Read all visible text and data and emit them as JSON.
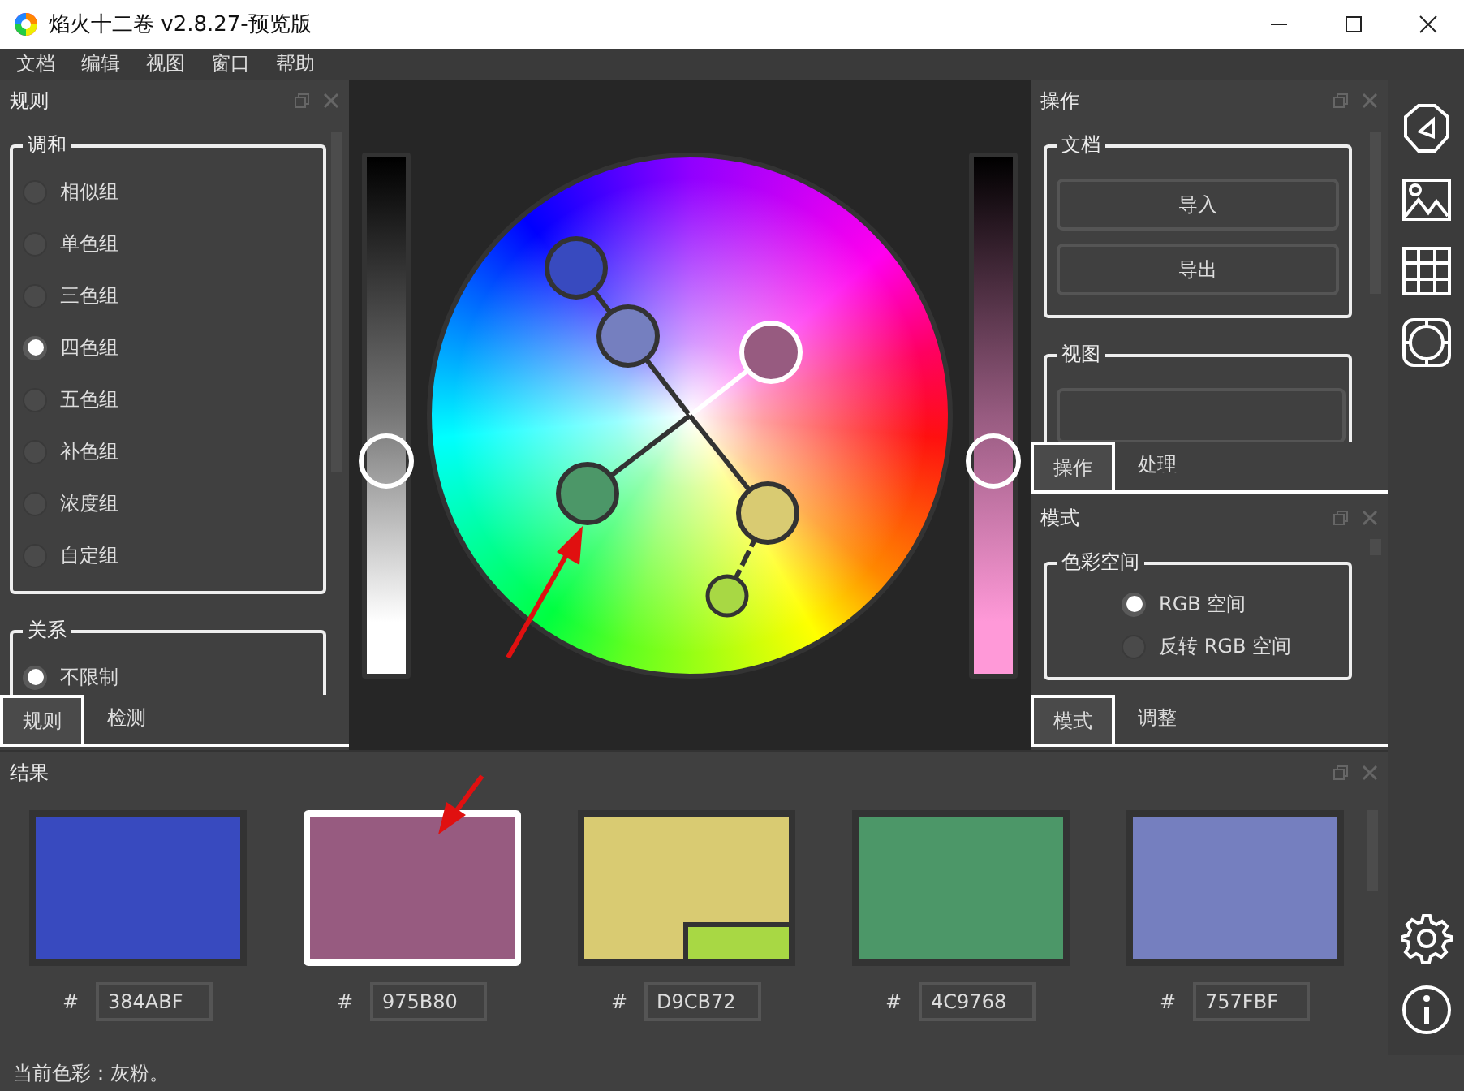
{
  "window": {
    "title": "焰火十二卷 v2.8.27-预览版"
  },
  "menu": [
    "文档",
    "编辑",
    "视图",
    "窗口",
    "帮助"
  ],
  "rules_panel": {
    "title": "规则",
    "groups": [
      {
        "title": "调和",
        "options": [
          {
            "label": "相似组",
            "selected": false
          },
          {
            "label": "单色组",
            "selected": false
          },
          {
            "label": "三色组",
            "selected": false
          },
          {
            "label": "四色组",
            "selected": true
          },
          {
            "label": "五色组",
            "selected": false
          },
          {
            "label": "补色组",
            "selected": false
          },
          {
            "label": "浓度组",
            "selected": false
          },
          {
            "label": "自定组",
            "selected": false
          }
        ]
      },
      {
        "title": "关系",
        "options": [
          {
            "label": "不限制",
            "selected": true
          }
        ]
      }
    ],
    "tabs": [
      {
        "label": "规则",
        "selected": true
      },
      {
        "label": "检测",
        "selected": false
      }
    ]
  },
  "wheel": {
    "left_slider": {
      "level": 0.41
    },
    "right_slider": {
      "level": 0.41
    }
  },
  "actions_panel": {
    "title": "操作",
    "groups": [
      {
        "title": "文档",
        "buttons": [
          "导入",
          "导出"
        ]
      },
      {
        "title": "视图"
      }
    ],
    "tabs": [
      {
        "label": "操作",
        "selected": true
      },
      {
        "label": "处理",
        "selected": false
      }
    ]
  },
  "mode_panel": {
    "title": "模式",
    "group": {
      "title": "色彩空间",
      "options": [
        {
          "label": "RGB 空间",
          "selected": true
        },
        {
          "label": "反转 RGB 空间",
          "selected": false
        }
      ]
    },
    "tabs": [
      {
        "label": "模式",
        "selected": true
      },
      {
        "label": "调整",
        "selected": false
      }
    ]
  },
  "results": {
    "title": "结果",
    "swatches": [
      {
        "color": "#384abf",
        "hash": "#",
        "hex": "384ABF",
        "selected": false
      },
      {
        "color": "#975b80",
        "hash": "#",
        "hex": "975B80",
        "selected": true
      },
      {
        "color": "#d9cb72",
        "hash": "#",
        "hex": "D9CB72",
        "selected": false,
        "sub_swatch": {
          "color": "#a8d844"
        }
      },
      {
        "color": "#4c9768",
        "hash": "#",
        "hex": "4C9768",
        "selected": false
      },
      {
        "color": "#757fbf",
        "hash": "#",
        "hex": "757FBF",
        "selected": false
      }
    ]
  },
  "status_bar": "当前色彩：灰粉。"
}
